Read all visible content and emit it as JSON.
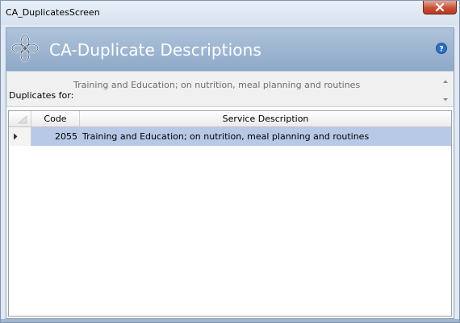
{
  "window": {
    "title": "CA_DuplicatesScreen",
    "close_label": "close"
  },
  "header": {
    "title": "CA-Duplicate Descriptions",
    "logo_icon": "celtic-knot-logo-icon",
    "help_icon": "help-icon"
  },
  "duplicates": {
    "label": "Duplicates for:",
    "value": "Training and Education; on nutrition, meal planning and routines"
  },
  "table": {
    "columns": [
      "Code",
      "Service Description"
    ],
    "rows": [
      {
        "code": "2055",
        "description": "Training and Education; on nutrition, meal planning and routines"
      }
    ]
  },
  "colors": {
    "header_bg": "#9db5d2",
    "selected_row": "#b7c9e6",
    "close_button": "#c9503a"
  }
}
